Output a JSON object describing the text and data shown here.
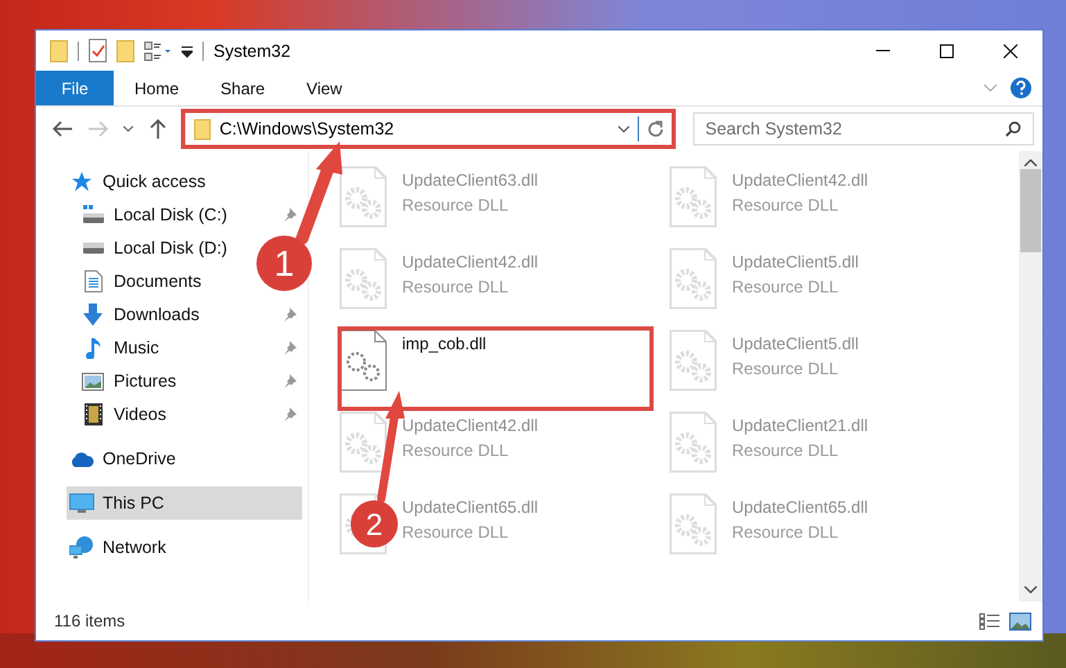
{
  "window": {
    "title": "System32"
  },
  "ribbon": {
    "tabs": [
      {
        "label": "File",
        "kind": "file"
      },
      {
        "label": "Home",
        "kind": "tab"
      },
      {
        "label": "Share",
        "kind": "tab"
      },
      {
        "label": "View",
        "kind": "tab"
      }
    ]
  },
  "address_bar": {
    "path": "C:\\Windows\\System32"
  },
  "search": {
    "placeholder": "Search System32"
  },
  "navigation": [
    {
      "label": "Quick access",
      "kind": "star",
      "selected": false,
      "children": [
        {
          "label": "Local Disk (C:)",
          "kind": "system-drive",
          "pinned": true,
          "selected": false
        },
        {
          "label": "Local Disk (D:)",
          "kind": "drive",
          "selected": false
        },
        {
          "label": "Documents",
          "kind": "documents",
          "selected": false
        },
        {
          "label": "Downloads",
          "kind": "downloads",
          "pinned": true,
          "selected": false
        },
        {
          "label": "Music",
          "kind": "music",
          "pinned": true,
          "selected": false
        },
        {
          "label": "Pictures",
          "kind": "pictures",
          "pinned": true,
          "selected": false
        },
        {
          "label": "Videos",
          "kind": "videos",
          "pinned": true,
          "selected": false
        }
      ]
    },
    {
      "label": "OneDrive",
      "kind": "cloud",
      "selected": false
    },
    {
      "label": "This PC",
      "kind": "computer",
      "selected": true
    },
    {
      "label": "Network",
      "kind": "network",
      "selected": false
    }
  ],
  "files": [
    {
      "name": "UpdateClient63.dll",
      "type": "Resource DLL",
      "faded": true
    },
    {
      "name": "UpdateClient42.dll",
      "type": "Resource DLL",
      "faded": true
    },
    {
      "name": "UpdateClient42.dll",
      "type": "Resource DLL",
      "faded": true
    },
    {
      "name": "UpdateClient5.dll",
      "type": "Resource DLL",
      "faded": true
    },
    {
      "name": "imp_cob.dll",
      "faded": false
    },
    {
      "name": "UpdateClient5.dll",
      "type": "Resource DLL",
      "faded": true
    },
    {
      "name": "UpdateClient42.dll",
      "type": "Resource DLL",
      "faded": true
    },
    {
      "name": "UpdateClient21.dll",
      "type": "Resource DLL",
      "faded": true
    },
    {
      "name": "UpdateClient65.dll",
      "type": "Resource DLL",
      "faded": true
    },
    {
      "name": "UpdateClient65.dll",
      "type": "Resource DLL",
      "faded": true
    }
  ],
  "status_bar": {
    "item_count": "116 items"
  },
  "annotations": [
    {
      "label": "1"
    },
    {
      "label": "2"
    }
  ]
}
